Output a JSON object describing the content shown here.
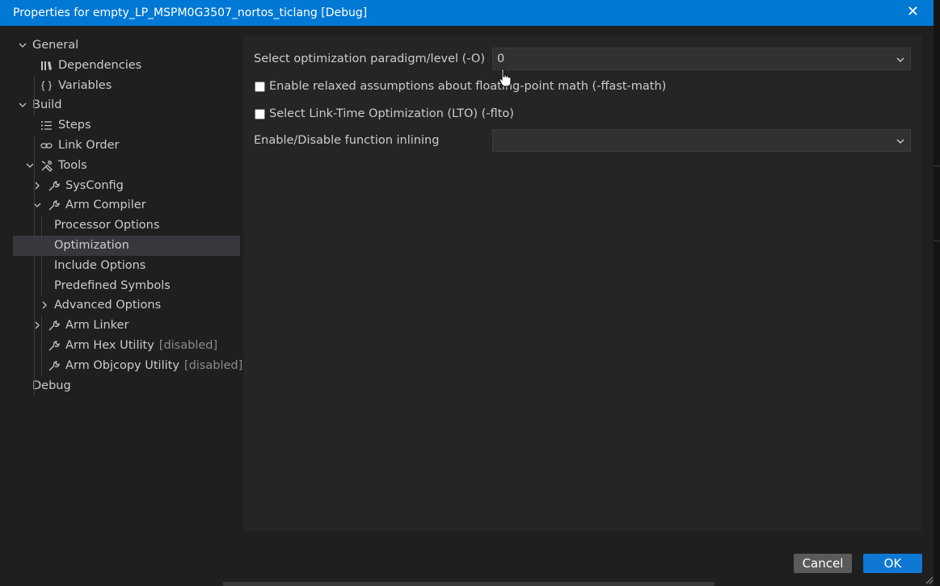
{
  "window": {
    "title": "Properties for empty_LP_MSPM0G3507_nortos_ticlang [Debug]",
    "close_glyph": "✕"
  },
  "tree": {
    "items": [
      {
        "label": "General",
        "depth": 0,
        "expanded": true,
        "icon": null
      },
      {
        "label": "Dependencies",
        "depth": 1,
        "icon": "library-icon"
      },
      {
        "label": "Variables",
        "depth": 1,
        "icon": "braces-icon"
      },
      {
        "label": "Build",
        "depth": 0,
        "expanded": true,
        "icon": null
      },
      {
        "label": "Steps",
        "depth": 1,
        "icon": "list-icon"
      },
      {
        "label": "Link Order",
        "depth": 1,
        "icon": "link-icon"
      },
      {
        "label": "Tools",
        "depth": 1,
        "expanded": true,
        "icon": "tools-icon"
      },
      {
        "label": "SysConfig",
        "depth": 2,
        "expanded": false,
        "icon": "wrench-icon"
      },
      {
        "label": "Arm Compiler",
        "depth": 2,
        "expanded": true,
        "icon": "wrench-icon"
      },
      {
        "label": "Processor Options",
        "depth": 3,
        "icon": null
      },
      {
        "label": "Optimization",
        "depth": 3,
        "icon": null,
        "selected": true
      },
      {
        "label": "Include Options",
        "depth": 3,
        "icon": null
      },
      {
        "label": "Predefined Symbols",
        "depth": 3,
        "icon": null
      },
      {
        "label": "Advanced Options",
        "depth": 3,
        "expanded": false,
        "icon": null
      },
      {
        "label": "Arm Linker",
        "depth": 2,
        "expanded": false,
        "icon": "wrench-icon"
      },
      {
        "label": "Arm Hex Utility",
        "depth": 2,
        "icon": "wrench-icon",
        "suffix": "[disabled]"
      },
      {
        "label": "Arm Objcopy Utility",
        "depth": 2,
        "icon": "wrench-icon",
        "suffix": "[disabled]"
      },
      {
        "label": "Debug",
        "depth": 0,
        "icon": null
      }
    ]
  },
  "options": {
    "opt_level": {
      "label": "Select optimization paradigm/level (-O)",
      "value": "0"
    },
    "fast_math": {
      "label": "Enable relaxed assumptions about floating-point math (-ffast-math)",
      "checked": false
    },
    "lto": {
      "label": "Select Link-Time Optimization (LTO) (-flto)",
      "checked": false
    },
    "inlining": {
      "label": "Enable/Disable function inlining",
      "value": ""
    }
  },
  "buttons": {
    "cancel": "Cancel",
    "ok": "OK"
  },
  "colors": {
    "accent": "#0078d4",
    "background": "#1f1f1f",
    "panel": "#252526",
    "selected_row": "#37373d"
  }
}
